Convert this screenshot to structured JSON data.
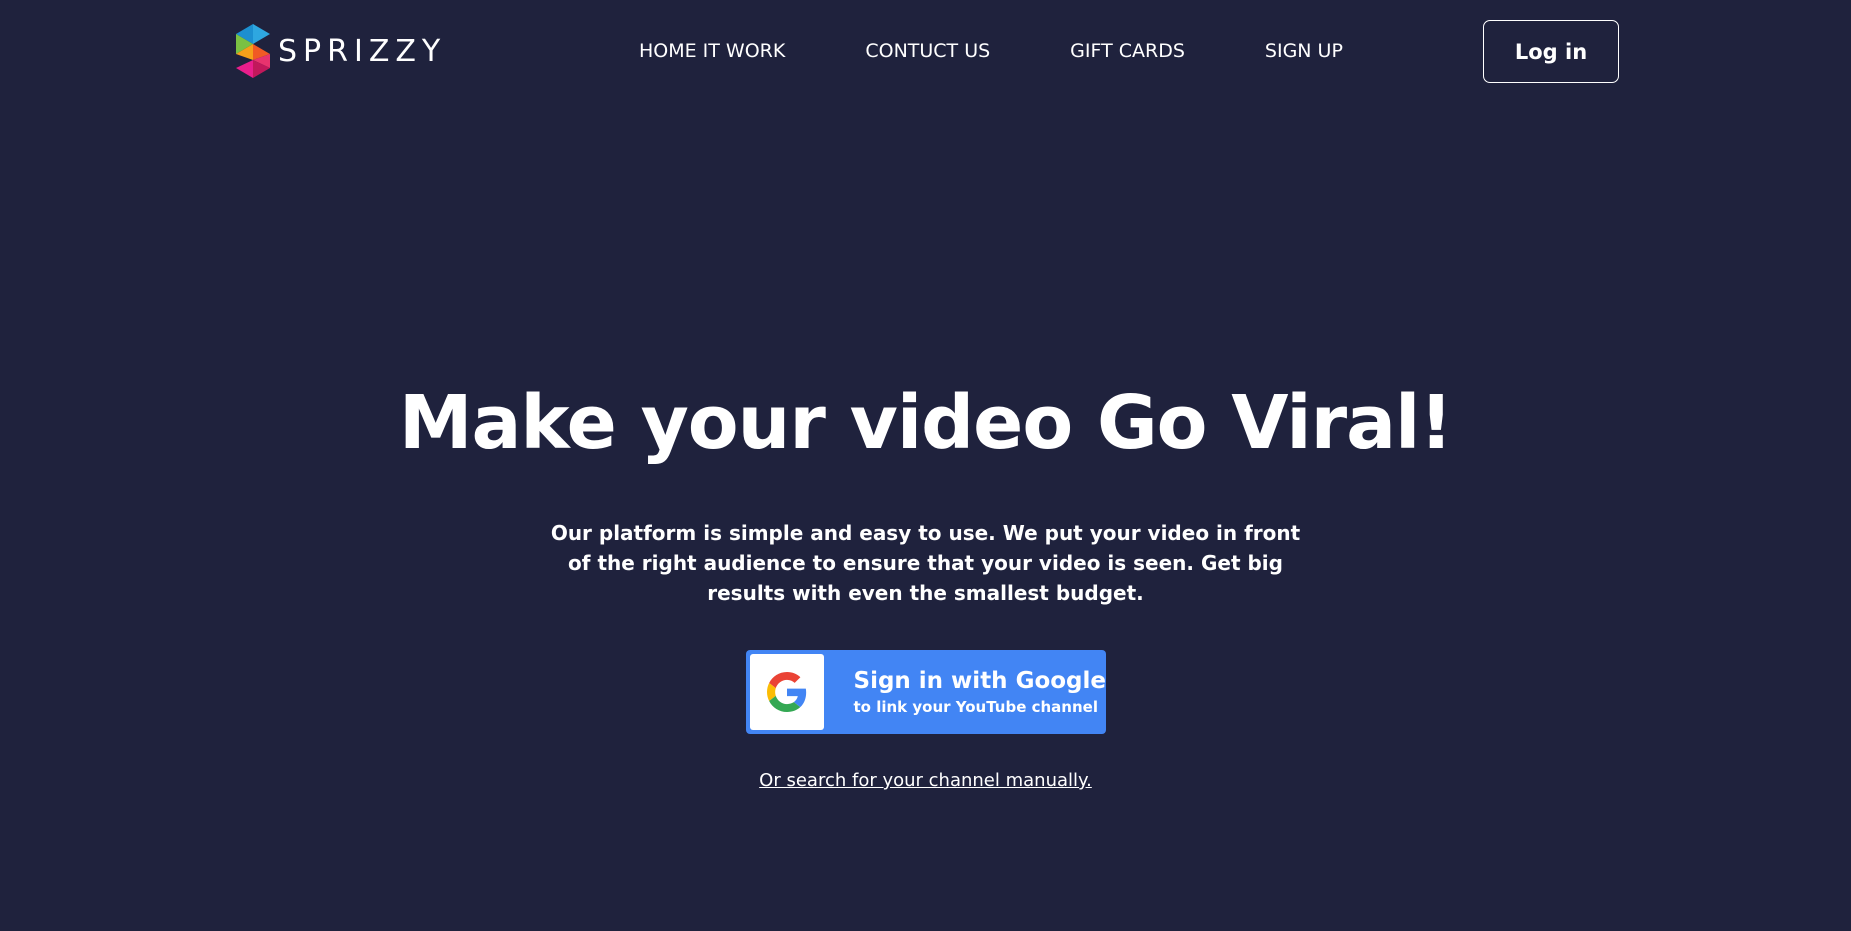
{
  "header": {
    "logo_text": "SPRIZZY",
    "nav": [
      {
        "label": "HOME IT WORK"
      },
      {
        "label": "CONTUCT US"
      },
      {
        "label": "GIFT CARDS"
      },
      {
        "label": "SIGN UP"
      }
    ],
    "login_label": "Log in"
  },
  "hero": {
    "title": "Make your video Go Viral!",
    "description": "Our platform is simple and easy to use. We put your video in front of the right audience to ensure that your video is seen. Get big results with even the smallest budget.",
    "google_button": {
      "title": "Sign in with Google",
      "subtitle": "to link your YouTube channel"
    },
    "manual_link": "Or search for your channel manually."
  },
  "colors": {
    "background": "#1f223d",
    "google_blue": "#4285f4",
    "text": "#ffffff"
  },
  "icons": {
    "logo": "sprizzy-logo-icon",
    "google": "google-g-icon"
  }
}
